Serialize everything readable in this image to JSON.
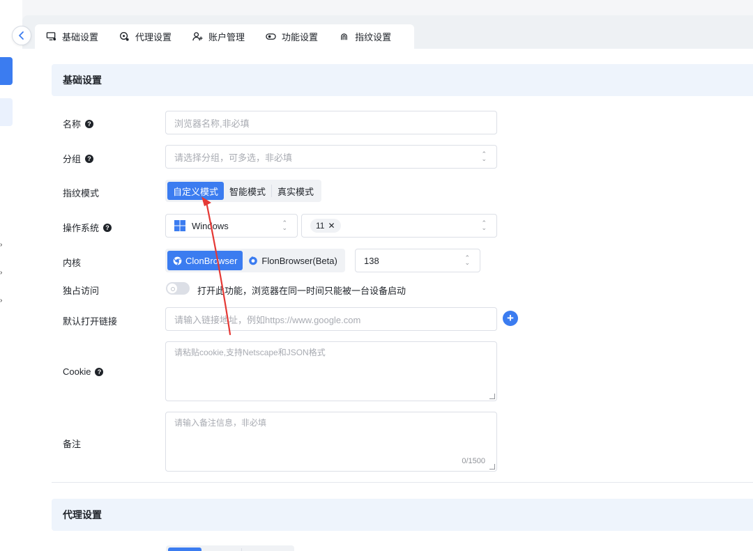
{
  "tabs": [
    {
      "label": "基础设置",
      "icon": "monitor-settings-icon"
    },
    {
      "label": "代理设置",
      "icon": "proxy-icon"
    },
    {
      "label": "账户管理",
      "icon": "user-add-icon"
    },
    {
      "label": "功能设置",
      "icon": "toggle-icon"
    },
    {
      "label": "指纹设置",
      "icon": "fingerprint-icon"
    }
  ],
  "basic_section": {
    "title": "基础设置",
    "name": {
      "label": "名称",
      "placeholder": "浏览器名称,非必填"
    },
    "group": {
      "label": "分组",
      "placeholder": "请选择分组，可多选，非必填"
    },
    "fingerprint_mode": {
      "label": "指纹模式",
      "options": [
        "自定义模式",
        "智能模式",
        "真实模式"
      ],
      "selected": "自定义模式"
    },
    "os": {
      "label": "操作系统",
      "value": "Windows",
      "version_tag": "11"
    },
    "kernel": {
      "label": "内核",
      "options": [
        "ClonBrowser",
        "FlonBrowser(Beta)"
      ],
      "selected": "ClonBrowser",
      "version": "138"
    },
    "exclusive": {
      "label": "独占访问",
      "description": "打开此功能，浏览器在同一时间只能被一台设备启动",
      "enabled": false
    },
    "default_link": {
      "label": "默认打开链接",
      "placeholder": "请输入链接地址，例如https://www.google.com"
    },
    "cookie": {
      "label": "Cookie",
      "placeholder": "请粘贴cookie,支持Netscape和JSON格式"
    },
    "remark": {
      "label": "备注",
      "placeholder": "请输入备注信息，非必填",
      "counter": "0/1500"
    }
  },
  "proxy_section": {
    "title": "代理设置"
  },
  "colors": {
    "accent": "#3b7cf0",
    "annotation_arrow": "#e53935"
  }
}
